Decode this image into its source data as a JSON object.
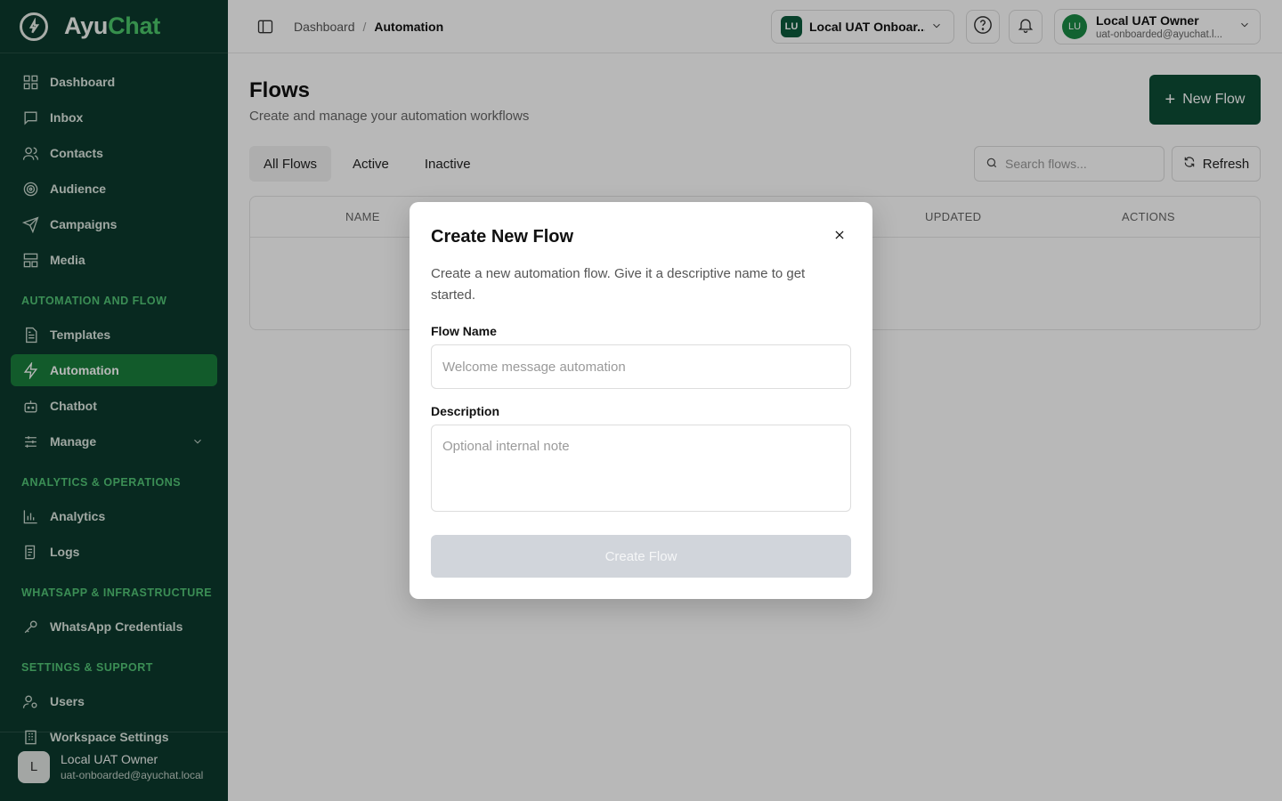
{
  "brand": {
    "name_main": "Ayu",
    "name_accent": "Chat"
  },
  "sidebar": {
    "items": [
      {
        "label": "Dashboard"
      },
      {
        "label": "Inbox"
      },
      {
        "label": "Contacts"
      },
      {
        "label": "Audience"
      },
      {
        "label": "Campaigns"
      },
      {
        "label": "Media"
      }
    ],
    "sections": [
      {
        "title": "AUTOMATION AND FLOW",
        "items": [
          {
            "label": "Templates"
          },
          {
            "label": "Automation",
            "active": true
          },
          {
            "label": "Chatbot"
          },
          {
            "label": "Manage"
          }
        ]
      },
      {
        "title": "ANALYTICS & OPERATIONS",
        "items": [
          {
            "label": "Analytics"
          },
          {
            "label": "Logs"
          }
        ]
      },
      {
        "title": "WHATSAPP & INFRASTRUCTURE",
        "items": [
          {
            "label": "WhatsApp Credentials"
          }
        ]
      },
      {
        "title": "SETTINGS & SUPPORT",
        "items": [
          {
            "label": "Users"
          },
          {
            "label": "Workspace Settings"
          }
        ]
      }
    ],
    "footer": {
      "avatar": "L",
      "name": "Local UAT Owner",
      "email": "uat-onboarded@ayuchat.local"
    }
  },
  "topbar": {
    "breadcrumb": [
      "Dashboard",
      "Automation"
    ],
    "breadcrumb_sep": "/",
    "workspace": {
      "badge": "LU",
      "name": "Local UAT Onboar..."
    },
    "user": {
      "avatar": "LU",
      "name": "Local UAT Owner",
      "email": "uat-onboarded@ayuchat.l..."
    }
  },
  "page": {
    "title": "Flows",
    "subtitle": "Create and manage your automation workflows",
    "new_flow_plus": "+",
    "new_flow_label": "New Flow",
    "tabs": [
      {
        "label": "All Flows",
        "active": true
      },
      {
        "label": "Active"
      },
      {
        "label": "Inactive"
      }
    ],
    "search_placeholder": "Search flows...",
    "refresh_label": "Refresh",
    "table_headers": [
      "NAME",
      "UPDATED",
      "ACTIONS"
    ]
  },
  "modal": {
    "title": "Create New Flow",
    "description": "Create a new automation flow. Give it a descriptive name to get started.",
    "flow_name_label": "Flow Name",
    "flow_name_placeholder": "Welcome message automation",
    "flow_name_value": "",
    "description_label": "Description",
    "description_placeholder": "Optional internal note",
    "description_value": "",
    "submit_label": "Create Flow"
  },
  "colors": {
    "sidebar_bg": "#0c3a2d",
    "active_item": "#1a7f3c",
    "section_label": "#53c577",
    "primary_button": "#0d4d35",
    "disabled_button": "#d1d5db"
  }
}
